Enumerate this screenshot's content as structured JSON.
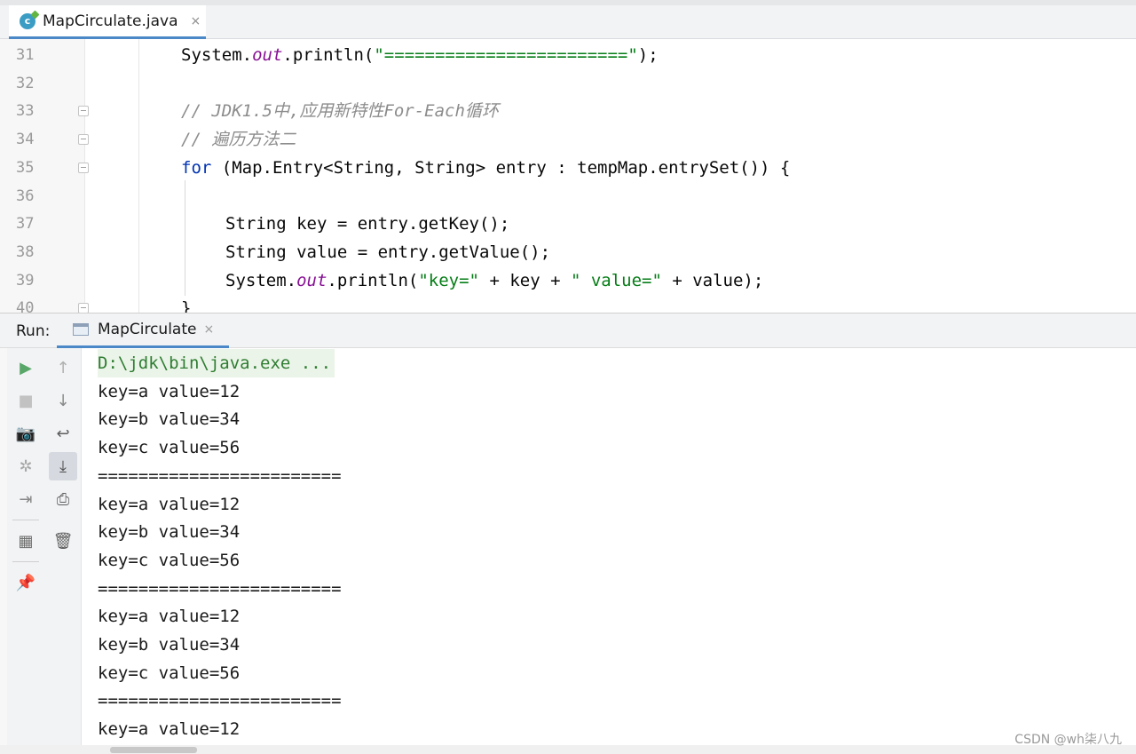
{
  "editor_tab": {
    "icon": "java-class-icon",
    "label": "MapCirculate.java",
    "close": "×"
  },
  "editor": {
    "lines": [
      {
        "num": "31",
        "indent": 2,
        "tokens": [
          {
            "t": "System.",
            "c": "plain"
          },
          {
            "t": "out",
            "c": "fld"
          },
          {
            "t": ".println(",
            "c": "plain"
          },
          {
            "t": "\"========================\"",
            "c": "str"
          },
          {
            "t": ");",
            "c": "plain"
          }
        ]
      },
      {
        "num": "32",
        "indent": 0,
        "tokens": []
      },
      {
        "num": "33",
        "indent": 2,
        "fold": true,
        "tokens": [
          {
            "t": "// JDK1.5中,应用新特性For-Each循环",
            "c": "cmt"
          }
        ]
      },
      {
        "num": "34",
        "indent": 2,
        "fold": true,
        "tokens": [
          {
            "t": "// 遍历方法二",
            "c": "cmt"
          }
        ]
      },
      {
        "num": "35",
        "indent": 2,
        "fold": true,
        "tokens": [
          {
            "t": "for",
            "c": "kw"
          },
          {
            "t": " (Map.Entry<String, String> entry : tempMap.entrySet()) {",
            "c": "plain"
          }
        ]
      },
      {
        "num": "36",
        "indent": 0,
        "tokens": []
      },
      {
        "num": "37",
        "indent": 3,
        "tokens": [
          {
            "t": "String key = entry.getKey();",
            "c": "plain"
          }
        ]
      },
      {
        "num": "38",
        "indent": 3,
        "tokens": [
          {
            "t": "String value = entry.getValue();",
            "c": "plain"
          }
        ]
      },
      {
        "num": "39",
        "indent": 3,
        "tokens": [
          {
            "t": "System.",
            "c": "plain"
          },
          {
            "t": "out",
            "c": "fld"
          },
          {
            "t": ".println(",
            "c": "plain"
          },
          {
            "t": "\"key=\"",
            "c": "str"
          },
          {
            "t": " + key + ",
            "c": "plain"
          },
          {
            "t": "\" value=\"",
            "c": "str"
          },
          {
            "t": " + value);",
            "c": "plain"
          }
        ]
      },
      {
        "num": "40",
        "indent": 2,
        "fold": true,
        "tokens": [
          {
            "t": "}",
            "c": "plain"
          }
        ]
      }
    ]
  },
  "run": {
    "label": "Run:",
    "tab_label": "MapCirculate",
    "tab_close": "×",
    "toolbar1": [
      {
        "name": "rerun-icon",
        "glyph": "▶",
        "color": "#59a869"
      },
      {
        "name": "stop-icon",
        "glyph": "■",
        "color": "#c2c2c2"
      },
      {
        "name": "camera-icon",
        "glyph": "📷",
        "color": "#8a8a8a"
      },
      {
        "name": "debug-bug-icon",
        "glyph": "✲",
        "color": "#a8a8a8"
      },
      {
        "name": "exit-icon",
        "glyph": "⇥",
        "color": "#8a8a8a"
      },
      {
        "name": "layout-icon",
        "glyph": "▦",
        "color": "#6e6e6e"
      },
      {
        "name": "pin-icon",
        "glyph": "📌",
        "color": "#7a7a7a"
      }
    ],
    "toolbar2": [
      {
        "name": "up-arrow-icon",
        "glyph": "↑",
        "color": "#b0b0b0"
      },
      {
        "name": "down-arrow-icon",
        "glyph": "↓",
        "color": "#8a8a8a"
      },
      {
        "name": "soft-wrap-icon",
        "glyph": "↩",
        "color": "#5e5e5e"
      },
      {
        "name": "scroll-to-end-icon",
        "glyph": "⤓",
        "color": "#4a4a4a",
        "active": true
      },
      {
        "name": "print-icon",
        "glyph": "⎙",
        "color": "#5e5e5e"
      },
      {
        "name": "trash-icon",
        "glyph": "🗑",
        "color": "#5e5e5e"
      }
    ],
    "console_lines": [
      {
        "text": "D:\\jdk\\bin\\java.exe ...",
        "cmd": true
      },
      {
        "text": "key=a value=12"
      },
      {
        "text": "key=b value=34"
      },
      {
        "text": "key=c value=56"
      },
      {
        "text": "========================"
      },
      {
        "text": "key=a value=12"
      },
      {
        "text": "key=b value=34"
      },
      {
        "text": "key=c value=56"
      },
      {
        "text": "========================"
      },
      {
        "text": "key=a value=12"
      },
      {
        "text": "key=b value=34"
      },
      {
        "text": "key=c value=56"
      },
      {
        "text": "========================"
      },
      {
        "text": "key=a value=12"
      }
    ]
  },
  "watermark": "CSDN @wh柒八九"
}
